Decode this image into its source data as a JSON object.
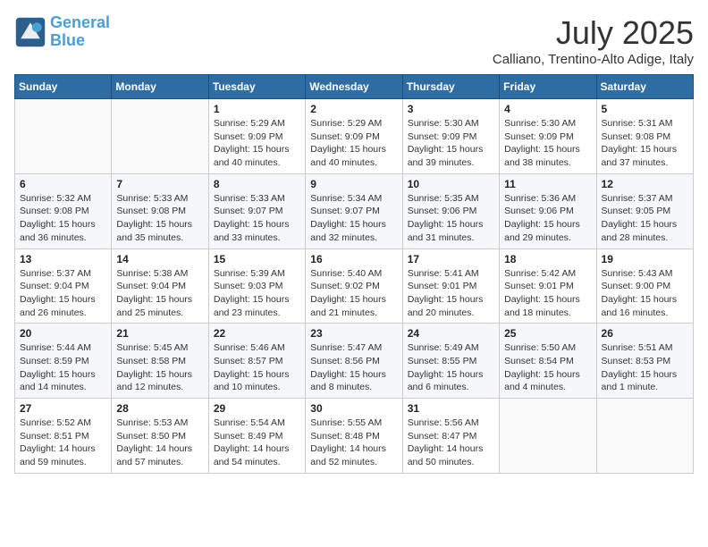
{
  "header": {
    "logo_line1": "General",
    "logo_line2": "Blue",
    "month": "July 2025",
    "location": "Calliano, Trentino-Alto Adige, Italy"
  },
  "weekdays": [
    "Sunday",
    "Monday",
    "Tuesday",
    "Wednesday",
    "Thursday",
    "Friday",
    "Saturday"
  ],
  "weeks": [
    [
      {
        "day": "",
        "info": ""
      },
      {
        "day": "",
        "info": ""
      },
      {
        "day": "1",
        "info": "Sunrise: 5:29 AM\nSunset: 9:09 PM\nDaylight: 15 hours and 40 minutes."
      },
      {
        "day": "2",
        "info": "Sunrise: 5:29 AM\nSunset: 9:09 PM\nDaylight: 15 hours and 40 minutes."
      },
      {
        "day": "3",
        "info": "Sunrise: 5:30 AM\nSunset: 9:09 PM\nDaylight: 15 hours and 39 minutes."
      },
      {
        "day": "4",
        "info": "Sunrise: 5:30 AM\nSunset: 9:09 PM\nDaylight: 15 hours and 38 minutes."
      },
      {
        "day": "5",
        "info": "Sunrise: 5:31 AM\nSunset: 9:08 PM\nDaylight: 15 hours and 37 minutes."
      }
    ],
    [
      {
        "day": "6",
        "info": "Sunrise: 5:32 AM\nSunset: 9:08 PM\nDaylight: 15 hours and 36 minutes."
      },
      {
        "day": "7",
        "info": "Sunrise: 5:33 AM\nSunset: 9:08 PM\nDaylight: 15 hours and 35 minutes."
      },
      {
        "day": "8",
        "info": "Sunrise: 5:33 AM\nSunset: 9:07 PM\nDaylight: 15 hours and 33 minutes."
      },
      {
        "day": "9",
        "info": "Sunrise: 5:34 AM\nSunset: 9:07 PM\nDaylight: 15 hours and 32 minutes."
      },
      {
        "day": "10",
        "info": "Sunrise: 5:35 AM\nSunset: 9:06 PM\nDaylight: 15 hours and 31 minutes."
      },
      {
        "day": "11",
        "info": "Sunrise: 5:36 AM\nSunset: 9:06 PM\nDaylight: 15 hours and 29 minutes."
      },
      {
        "day": "12",
        "info": "Sunrise: 5:37 AM\nSunset: 9:05 PM\nDaylight: 15 hours and 28 minutes."
      }
    ],
    [
      {
        "day": "13",
        "info": "Sunrise: 5:37 AM\nSunset: 9:04 PM\nDaylight: 15 hours and 26 minutes."
      },
      {
        "day": "14",
        "info": "Sunrise: 5:38 AM\nSunset: 9:04 PM\nDaylight: 15 hours and 25 minutes."
      },
      {
        "day": "15",
        "info": "Sunrise: 5:39 AM\nSunset: 9:03 PM\nDaylight: 15 hours and 23 minutes."
      },
      {
        "day": "16",
        "info": "Sunrise: 5:40 AM\nSunset: 9:02 PM\nDaylight: 15 hours and 21 minutes."
      },
      {
        "day": "17",
        "info": "Sunrise: 5:41 AM\nSunset: 9:01 PM\nDaylight: 15 hours and 20 minutes."
      },
      {
        "day": "18",
        "info": "Sunrise: 5:42 AM\nSunset: 9:01 PM\nDaylight: 15 hours and 18 minutes."
      },
      {
        "day": "19",
        "info": "Sunrise: 5:43 AM\nSunset: 9:00 PM\nDaylight: 15 hours and 16 minutes."
      }
    ],
    [
      {
        "day": "20",
        "info": "Sunrise: 5:44 AM\nSunset: 8:59 PM\nDaylight: 15 hours and 14 minutes."
      },
      {
        "day": "21",
        "info": "Sunrise: 5:45 AM\nSunset: 8:58 PM\nDaylight: 15 hours and 12 minutes."
      },
      {
        "day": "22",
        "info": "Sunrise: 5:46 AM\nSunset: 8:57 PM\nDaylight: 15 hours and 10 minutes."
      },
      {
        "day": "23",
        "info": "Sunrise: 5:47 AM\nSunset: 8:56 PM\nDaylight: 15 hours and 8 minutes."
      },
      {
        "day": "24",
        "info": "Sunrise: 5:49 AM\nSunset: 8:55 PM\nDaylight: 15 hours and 6 minutes."
      },
      {
        "day": "25",
        "info": "Sunrise: 5:50 AM\nSunset: 8:54 PM\nDaylight: 15 hours and 4 minutes."
      },
      {
        "day": "26",
        "info": "Sunrise: 5:51 AM\nSunset: 8:53 PM\nDaylight: 15 hours and 1 minute."
      }
    ],
    [
      {
        "day": "27",
        "info": "Sunrise: 5:52 AM\nSunset: 8:51 PM\nDaylight: 14 hours and 59 minutes."
      },
      {
        "day": "28",
        "info": "Sunrise: 5:53 AM\nSunset: 8:50 PM\nDaylight: 14 hours and 57 minutes."
      },
      {
        "day": "29",
        "info": "Sunrise: 5:54 AM\nSunset: 8:49 PM\nDaylight: 14 hours and 54 minutes."
      },
      {
        "day": "30",
        "info": "Sunrise: 5:55 AM\nSunset: 8:48 PM\nDaylight: 14 hours and 52 minutes."
      },
      {
        "day": "31",
        "info": "Sunrise: 5:56 AM\nSunset: 8:47 PM\nDaylight: 14 hours and 50 minutes."
      },
      {
        "day": "",
        "info": ""
      },
      {
        "day": "",
        "info": ""
      }
    ]
  ]
}
